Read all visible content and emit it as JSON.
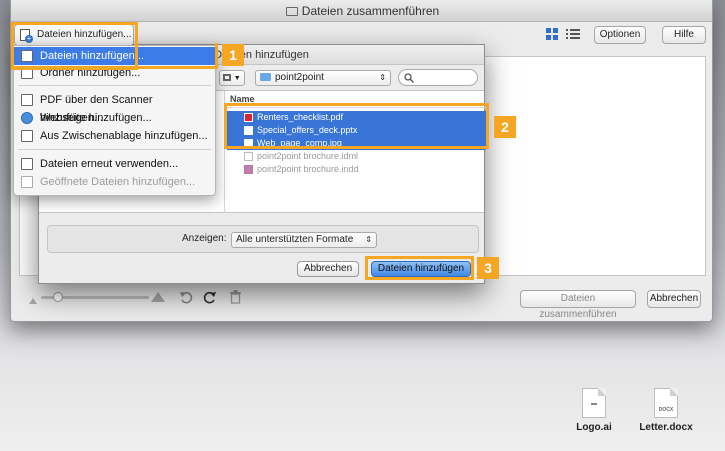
{
  "window": {
    "title": "Dateien zusammenführen",
    "options_label": "Optionen",
    "help_label": "Hilfe",
    "add_files_label": "Dateien hinzufügen...",
    "merge_label": "Dateien zusammenführen",
    "cancel_label": "Abbrechen"
  },
  "menu": {
    "items": [
      {
        "label": "Dateien hinzufügen...",
        "icon": "add-file-icon"
      },
      {
        "label": "Ordner hinzufügen...",
        "icon": "add-folder-icon"
      },
      {
        "label": "PDF über den Scanner hinzufügen...",
        "icon": "scanner-icon"
      },
      {
        "label": "Webseite hinzufügen...",
        "icon": "web-icon"
      },
      {
        "label": "Aus Zwischenablage hinzufügen...",
        "icon": "clipboard-icon"
      },
      {
        "label": "Dateien erneut verwenden...",
        "icon": "reuse-files-icon"
      },
      {
        "label": "Geöffnete Dateien hinzufügen...",
        "icon": "open-files-icon"
      }
    ]
  },
  "dialog": {
    "title": "Dateien hinzufügen",
    "location": "point2point",
    "column_name": "Name",
    "files": [
      {
        "name": "Renters_checklist.pdf",
        "selected": true
      },
      {
        "name": "Special_offers_deck.pptx",
        "selected": true
      },
      {
        "name": "Web_page_comp.jpg",
        "selected": true
      },
      {
        "name": "point2point brochure.idml",
        "selected": false
      },
      {
        "name": "point2point brochure.indd",
        "selected": false
      }
    ],
    "show_label": "Anzeigen:",
    "format_value": "Alle unterstützten Formate",
    "cancel_label": "Abbrechen",
    "confirm_label": "Dateien hinzufügen"
  },
  "callouts": [
    "1",
    "2",
    "3"
  ],
  "desktop": {
    "files": [
      {
        "name": "Logo.ai",
        "badge": ""
      },
      {
        "name": "Letter.docx",
        "badge": "DOCX"
      }
    ]
  },
  "colors": {
    "accent": "#f5a623",
    "selection": "#3875d7",
    "menu_highlight": "#3c7be8"
  }
}
